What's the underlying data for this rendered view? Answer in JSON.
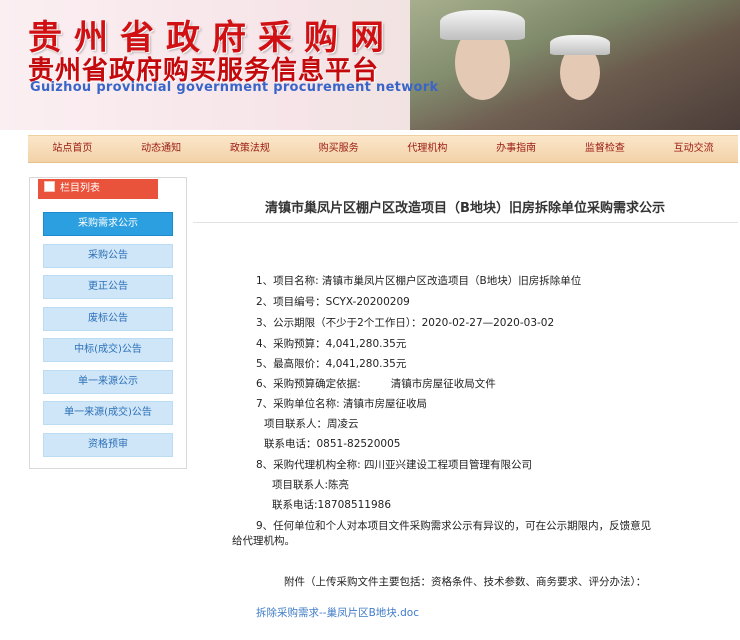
{
  "banner": {
    "title_cn": "贵州省政府采购网",
    "subtitle_cn": "贵州省政府购买服务信息平台",
    "title_en": "Guizhou provincial government procurement network"
  },
  "nav": {
    "items": [
      "站点首页",
      "动态通知",
      "政策法规",
      "购买服务",
      "代理机构",
      "办事指南",
      "监督检查",
      "互动交流"
    ]
  },
  "sidebar": {
    "heading": "栏目列表",
    "items": [
      "采购需求公示",
      "采购公告",
      "更正公告",
      "废标公告",
      "中标(成交)公告",
      "单一来源公示",
      "单一来源(成交)公告",
      "资格预审"
    ],
    "active_index": 0
  },
  "article": {
    "title": "清镇市巢凤片区棚户区改造项目（B地块）旧房拆除单位采购需求公示",
    "lines": [
      "1、项目名称: 清镇市巢凤片区棚户区改造项目（B地块）旧房拆除单位",
      "2、项目编号：SCYX-20200209",
      "3、公示期限（不少于2个工作日）：2020-02-27—2020-03-02",
      "4、采购预算：4,041,280.35元",
      "5、最高限价：4,041,280.35元",
      "6、采购预算确定依据:         清镇市房屋征收局文件",
      "7、采购单位名称: 清镇市房屋征收局",
      "项目联系人：周凌云",
      "联系电话：0851-82520005",
      "8、采购代理机构全称: 四川亚兴建设工程项目管理有限公司",
      "项目联系人:陈亮",
      "联系电话:18708511986",
      "9、任何单位和个人对本项目文件采购需求公示有异议的，可在公示期限内，反馈意见",
      "给代理机构。",
      "附件（上传采购文件主要包括：资格条件、技术参数、商务要求、评分办法）：",
      "拆除采购需求--巢凤片区B地块.doc"
    ]
  },
  "colors": {
    "title_red": "#d01013",
    "nav_bg": "#f5d9b3",
    "sidebar_active": "#2b9fe0",
    "sidebar_item": "#cfe6f8",
    "link": "#3f7cc7"
  }
}
